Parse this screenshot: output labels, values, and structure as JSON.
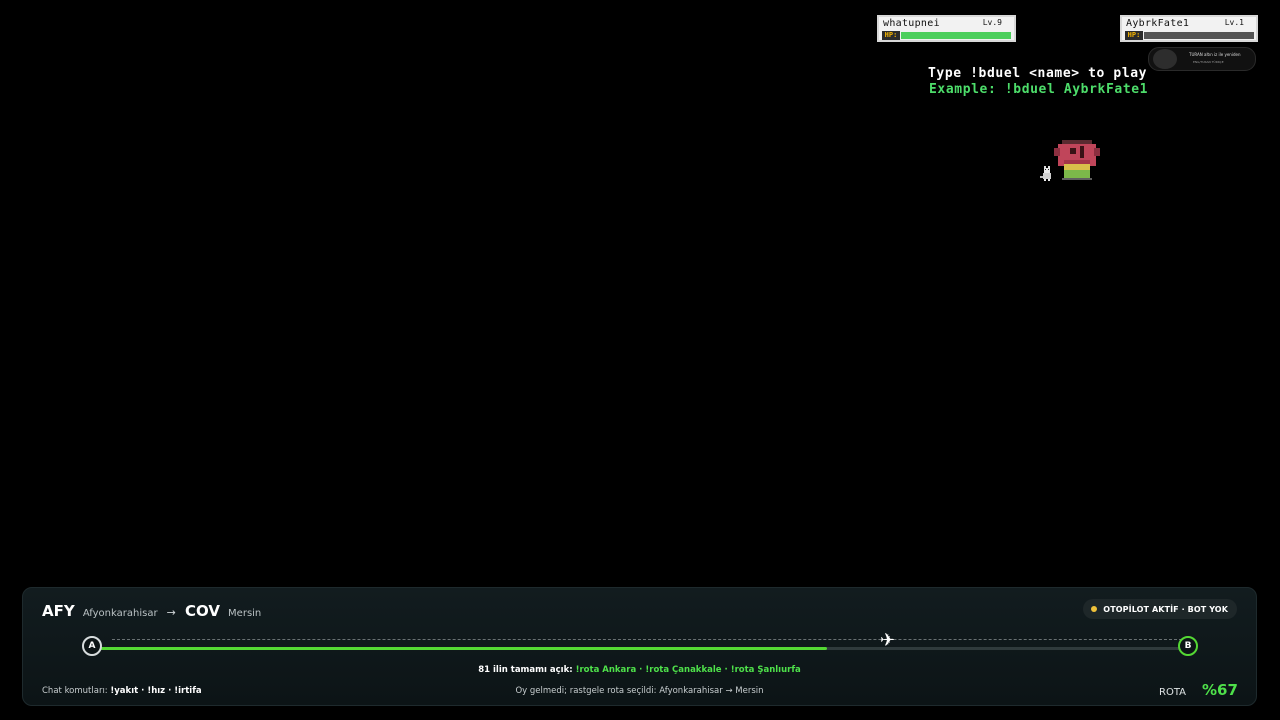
{
  "players": [
    {
      "name": "whatupnei",
      "level": "Lv.9",
      "hp_label": "HP:",
      "hp_fraction": 1.0
    },
    {
      "name": "AybrkFate1",
      "level": "Lv.1",
      "hp_label": "HP:",
      "hp_fraction": 0.0
    }
  ],
  "badge": {
    "title": "TURAN altın iz ile yeniden",
    "sub": "ENG/TURAN TÜRKÇE"
  },
  "instructions": {
    "line1": "Type !bduel <name> to play",
    "line2": "Example: !bduel AybrkFate1"
  },
  "flight": {
    "origin_code": "AFY",
    "origin_city": "Afyonkarahisar",
    "arrow": "→",
    "dest_code": "COV",
    "dest_city": "Mersin",
    "status": "OTOPİLOT AKTİF · BOT YOK",
    "node_a": "A",
    "node_b": "B",
    "progress_fraction": 0.67,
    "plane_icon": "✈",
    "routes_prefix": "81 ilin tamamı açık:",
    "route_options": [
      {
        "text": "!rota Ankara",
        "sep": " · "
      },
      {
        "text": "!rota Çanakkale",
        "sep": " · "
      },
      {
        "text": "!rota Şanlıurfa",
        "sep": ""
      }
    ],
    "chat_label": "Chat komutları:",
    "chat_commands": "!yakıt · !hız · !irtifa",
    "vote_text": "Oy gelmedi; rastgele rota seçildi: Afyonkarahisar → Mersin",
    "rota_label": "ROTA",
    "percent": "%67"
  },
  "colors": {
    "accent_green": "#54d834",
    "status_dot": "#f0c23a",
    "hp_fill": "#4ccf5c"
  }
}
